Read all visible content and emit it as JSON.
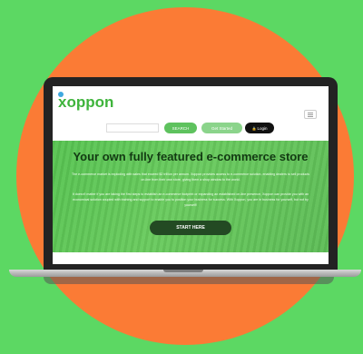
{
  "colors": {
    "background": "#5cd863",
    "circle": "#fb7b35",
    "brand_green": "#3fb43c",
    "login_button": "#111111",
    "start_button": "#234a23"
  },
  "header": {
    "logo_text": "xoppon",
    "menu_icon": "hamburger-icon"
  },
  "search": {
    "placeholder": "",
    "button_label": "SEARCH"
  },
  "actions": {
    "get_started_label": "Get Started",
    "login_label": "Login",
    "login_icon": "lock-icon"
  },
  "hero": {
    "title": "Your own fully featured e-commerce store",
    "paragraph_1": "The e-commerce market is exploding with sales that exceed $2 trillion per annum. Xoppon provides access to e-commerce solution, enabling dealers to sell products on-line from their own store, giving them a shop window to the world.",
    "paragraph_2": "It doesn't matter if you are taking the first steps to establish an e-commerce footprint or expanding an established on-line presence, Xoppon can provide you with an economical solution coupled with training and support to enable you to position your business for success. With Xoppon, you are in business for yourself, but not by yourself!",
    "cta_label": "START HERE"
  }
}
